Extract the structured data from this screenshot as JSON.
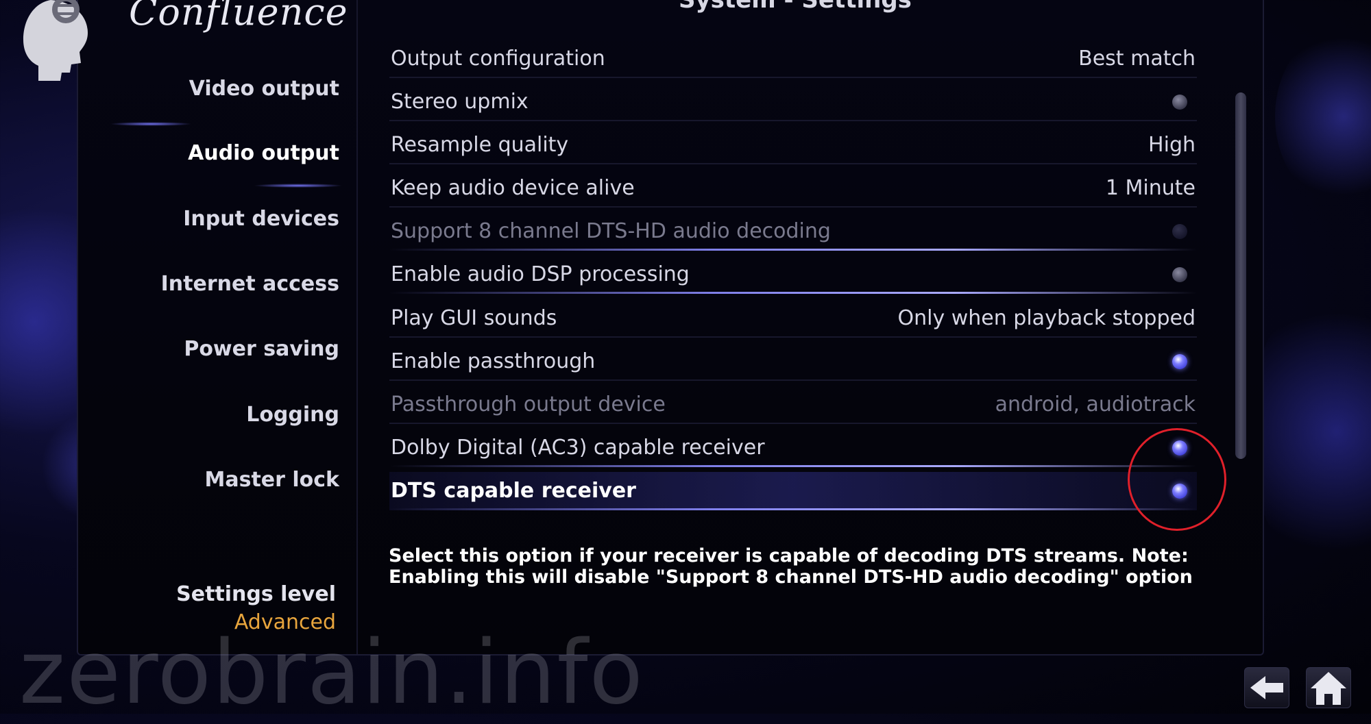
{
  "app": {
    "brand": "Confluence",
    "window_title": "System - Settings"
  },
  "sidebar": {
    "items": [
      {
        "label": "Video output",
        "active": false
      },
      {
        "label": "Audio output",
        "active": true
      },
      {
        "label": "Input devices",
        "active": false
      },
      {
        "label": "Internet access",
        "active": false
      },
      {
        "label": "Power saving",
        "active": false
      },
      {
        "label": "Logging",
        "active": false
      },
      {
        "label": "Master lock",
        "active": false
      }
    ],
    "settings_level": {
      "label": "Settings level",
      "value": "Advanced"
    }
  },
  "settings": [
    {
      "label": "Output configuration",
      "value": "Best match"
    },
    {
      "label": "Stereo upmix",
      "toggle": "off"
    },
    {
      "label": "Resample quality",
      "value": "High"
    },
    {
      "label": "Keep audio device alive",
      "value": "1 Minute"
    },
    {
      "label": "Support 8 channel DTS-HD audio decoding",
      "toggle": "off",
      "disabled": true
    },
    {
      "label": "Enable audio DSP processing",
      "toggle": "off"
    },
    {
      "label": "Play GUI sounds",
      "value": "Only when playback stopped"
    },
    {
      "label": "Enable passthrough",
      "toggle": "on"
    },
    {
      "label": "Passthrough output device",
      "value": "android, audiotrack",
      "disabled": true
    },
    {
      "label": "Dolby Digital (AC3) capable receiver",
      "toggle": "on"
    },
    {
      "label": "DTS capable receiver",
      "toggle": "on",
      "focused": true
    }
  ],
  "description": "Select this option if your receiver is capable of decoding DTS streams. Note: Enabling this will disable \"Support 8 channel DTS-HD audio decoding\" option",
  "watermark": "zerobrain.info",
  "icons": {
    "logo": "head-brain-icon",
    "back": "back-arrow-icon",
    "home": "home-icon"
  },
  "colors": {
    "accent": "#7d7dff",
    "settings_level_value": "#e8a53d",
    "annotation": "#e0202a"
  }
}
